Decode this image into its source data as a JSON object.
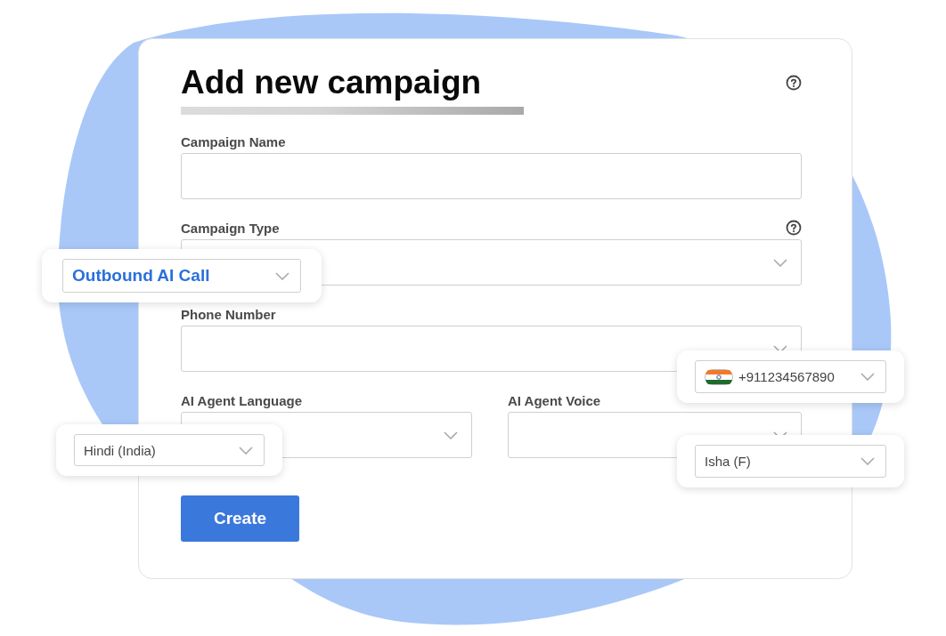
{
  "form": {
    "title": "Add new campaign",
    "help": true,
    "fields": [
      {
        "label": "Campaign Name",
        "kind": "text",
        "help": false
      },
      {
        "label": "Campaign Type",
        "kind": "select",
        "help": true
      },
      {
        "label": "Phone Number",
        "kind": "select",
        "help": false
      }
    ],
    "pair": [
      {
        "label": "AI Agent Language",
        "kind": "select",
        "help": false
      },
      {
        "label": "AI Agent Voice",
        "kind": "select",
        "help": false
      }
    ],
    "button": "Create"
  },
  "callouts": [
    {
      "value": "Outbound AI Call",
      "kind": "select",
      "highlighted": true
    },
    {
      "value": "+911234567890",
      "kind": "phone",
      "highlighted": false
    },
    {
      "value": "Hindi (India)",
      "kind": "select",
      "highlighted": false
    },
    {
      "value": "Isha (F)",
      "kind": "select",
      "highlighted": false
    }
  ]
}
